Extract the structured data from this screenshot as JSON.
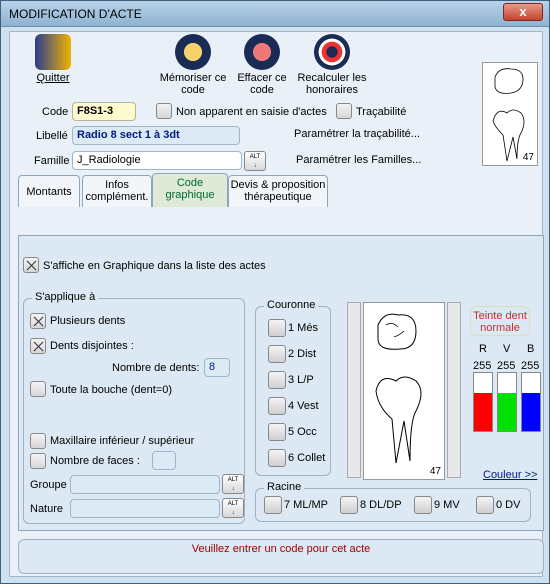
{
  "window": {
    "title": "MODIFICATION D'ACTE",
    "close_label": "x"
  },
  "toolbar": {
    "quit": {
      "label": "Quitter",
      "icon": "door-exit-icon"
    },
    "memorize": {
      "label": "Mémoriser ce code",
      "icon": "save-code-icon"
    },
    "erase": {
      "label": "Effacer ce code",
      "icon": "eraser-icon"
    },
    "recalc": {
      "label": "Recalculer les honoraires",
      "icon": "lifebuoy-icon"
    }
  },
  "form": {
    "code_label": "Code",
    "code_value": "F8S1-3",
    "non_apparent_label": "Non apparent en saisie d'actes",
    "tracabilite_label": "Traçabilité",
    "libelle_label": "Libellé",
    "libelle_value": "Radio 8 sect 1 à 3dt",
    "param_trac_label": "Paramétrer la traçabilité...",
    "famille_label": "Famille",
    "famille_value": "J_Radiologie",
    "param_fam_label": "Paramétrer les Familles...",
    "alt_label": "ALT"
  },
  "preview": {
    "tooth_number": "47"
  },
  "tabs": [
    {
      "label": "Montants"
    },
    {
      "label": "Infos complément."
    },
    {
      "label": "Code graphique"
    },
    {
      "label": "Devis & proposition thérapeutique"
    }
  ],
  "graphique": {
    "show_label": "S'affiche en Graphique dans la liste des actes",
    "applies_title": "S'applique à",
    "plusieurs_dents": "Plusieurs dents",
    "dents_disjointes": "Dents disjointes :",
    "nombre_dents_label": "Nombre de dents:",
    "nombre_dents_value": "8",
    "toute_bouche": "Toute la bouche (dent=0)",
    "maxillaire": "Maxillaire inférieur / supérieur",
    "nombre_faces": "Nombre de faces :",
    "groupe_label": "Groupe",
    "nature_label": "Nature",
    "couronne_title": "Couronne",
    "couronne_items": [
      "1 Més",
      "2 Dist",
      "3 L/P",
      "4 Vest",
      "5 Occ",
      "6 Collet"
    ],
    "tooth_number": "47",
    "teinte_label": "Teinte dent normale",
    "rgb_labels": [
      "R",
      "V",
      "B"
    ],
    "rgb_values": [
      "255",
      "255",
      "255"
    ],
    "rgb_colors": [
      "#ff0000",
      "#00e000",
      "#0000ff"
    ],
    "couleur_link": "Couleur >>",
    "racine_title": "Racine",
    "racine_items": [
      "7 ML/MP",
      "8 DL/DP",
      "9 MV",
      "0 DV"
    ]
  },
  "status": {
    "message": "Veuillez entrer un code pour cet acte"
  }
}
